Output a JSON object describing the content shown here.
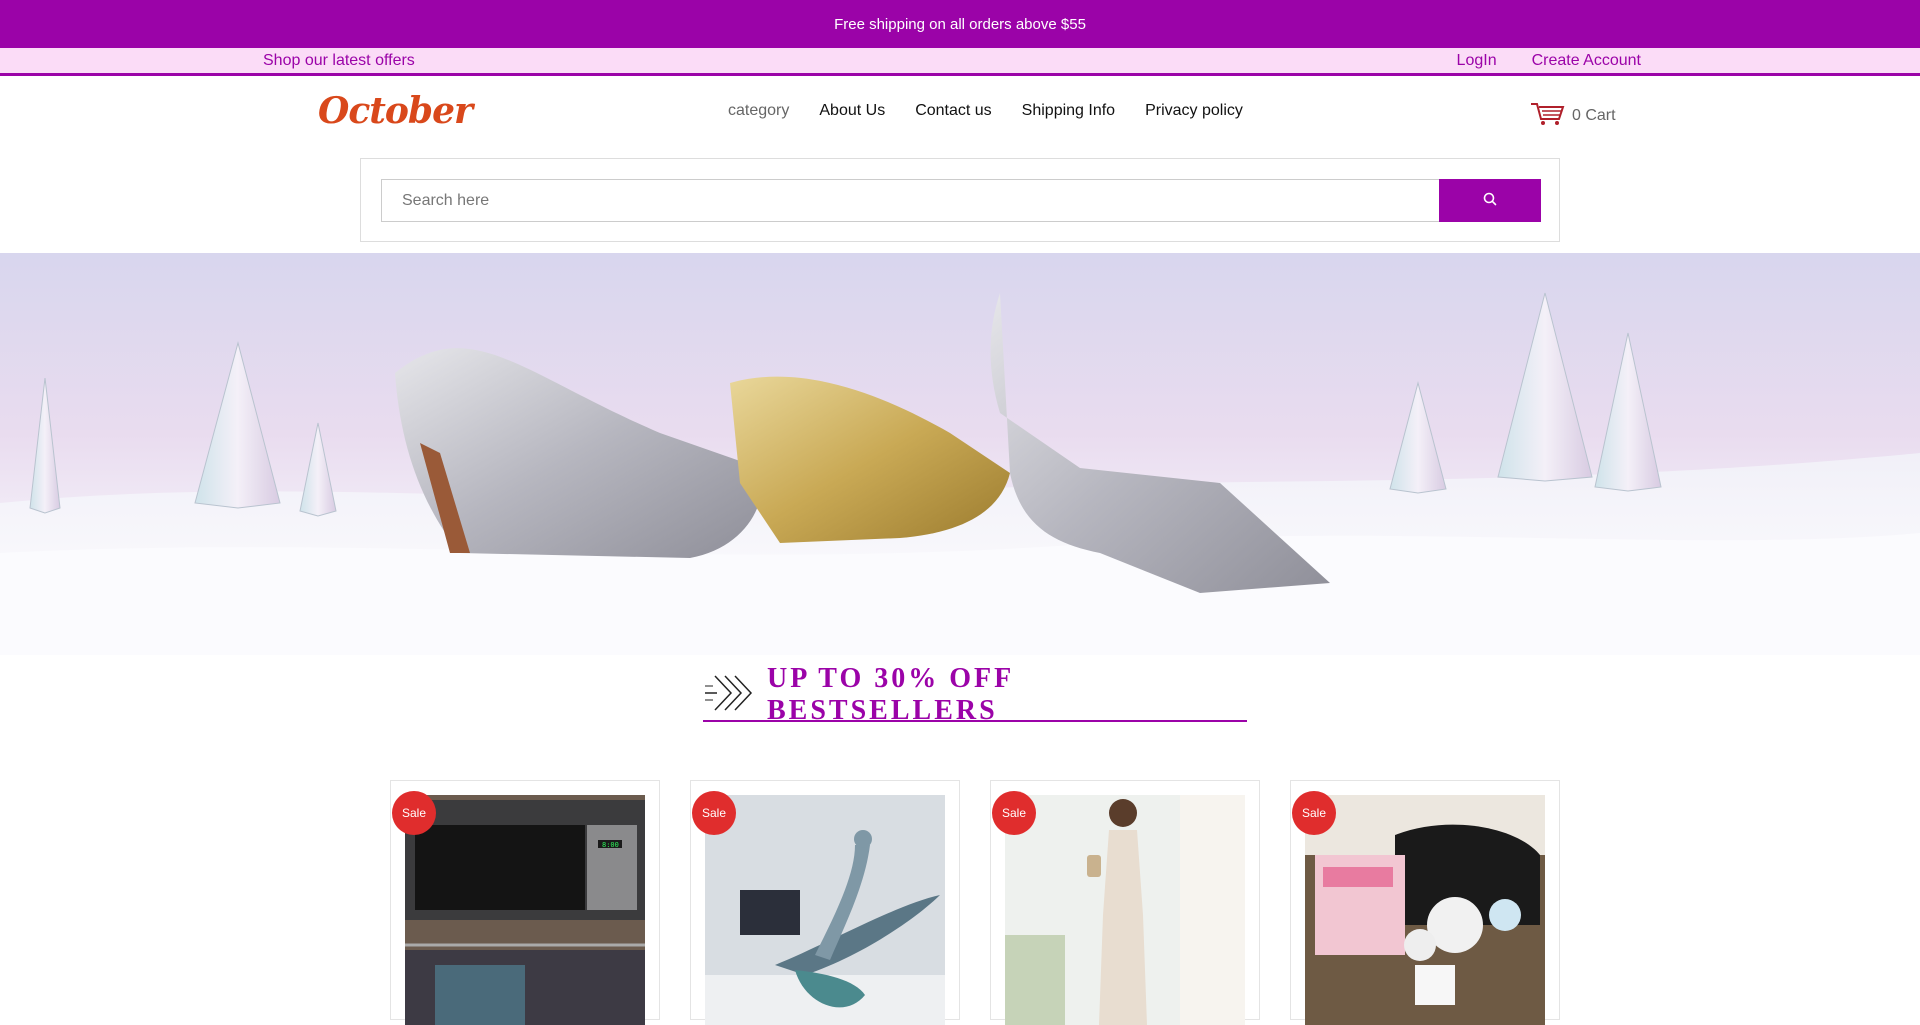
{
  "announcement": "Free shipping on all orders above $55",
  "subbar": {
    "offers_link": "Shop our latest offers",
    "login": "LogIn",
    "create_account": "Create Account"
  },
  "brand": {
    "logo_text": "October",
    "logo_color": "#d9481b"
  },
  "nav": {
    "items": [
      {
        "label": "category"
      },
      {
        "label": "About Us"
      },
      {
        "label": "Contact us"
      },
      {
        "label": "Shipping Info"
      },
      {
        "label": "Privacy policy"
      }
    ]
  },
  "cart": {
    "label": "0 Cart",
    "icon": "cart-icon"
  },
  "search": {
    "placeholder": "Search here",
    "icon": "search-icon"
  },
  "promo": {
    "title": "UP TO 30% OFF BESTSELLERS",
    "icon": "double-chevron-right-icon"
  },
  "products": [
    {
      "badge": "Sale",
      "image": "microwave"
    },
    {
      "badge": "Sale",
      "image": "surfer-statue"
    },
    {
      "badge": "Sale",
      "image": "white-dress"
    },
    {
      "badge": "Sale",
      "image": "breast-pump"
    }
  ],
  "colors": {
    "accent": "#9b03a8",
    "subbar_bg": "#fbdcf7",
    "sale_badge": "#e02d2d"
  }
}
